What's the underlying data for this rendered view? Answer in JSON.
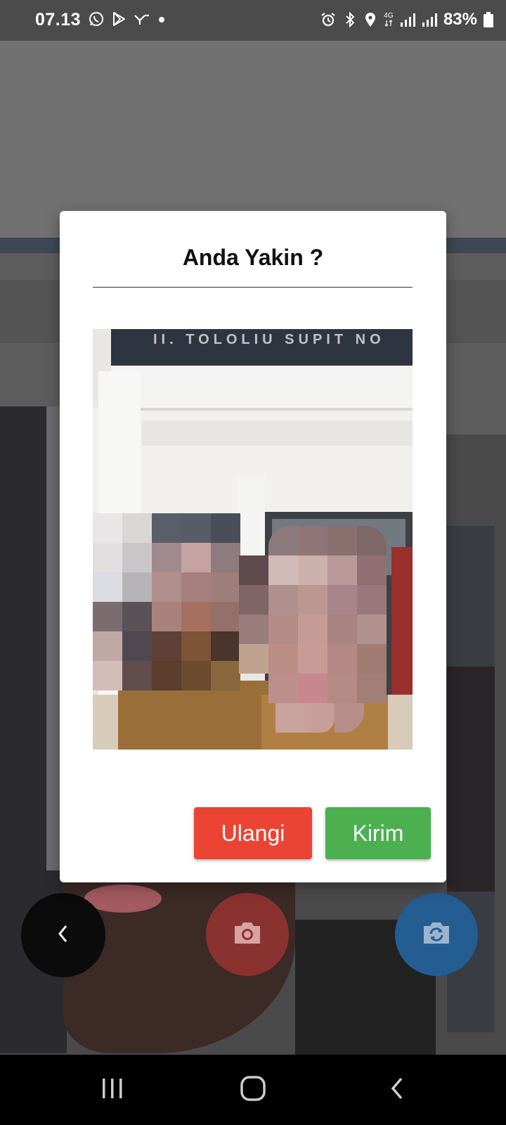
{
  "status_bar": {
    "time": "07.13",
    "battery": "83%",
    "network_label": "4G",
    "left_icons": [
      "whatsapp-icon",
      "play-store-icon",
      "signal-app-icon",
      "dot-icon"
    ],
    "right_icons": [
      "alarm-icon",
      "bluetooth-icon",
      "location-icon",
      "network-4g-icon",
      "signal-bars-icon",
      "signal-bars-icon",
      "battery-icon"
    ]
  },
  "dialog": {
    "title": "Anda Yakin ?",
    "preview_sign_text": "II. TOLOLIU SUPIT NO",
    "retake_label": "Ulangi",
    "send_label": "Kirim"
  },
  "camera_controls": {
    "capture_icon": "camera-icon",
    "switch_icon": "switch-camera-icon",
    "back_icon": "back-icon"
  },
  "colors": {
    "retake": "#eb4435",
    "send": "#4caf50",
    "capture_fab": "#8a3230",
    "switch_fab": "#245d92"
  },
  "nav_bar": {
    "icons": [
      "recents-icon",
      "home-icon",
      "back-icon"
    ]
  }
}
